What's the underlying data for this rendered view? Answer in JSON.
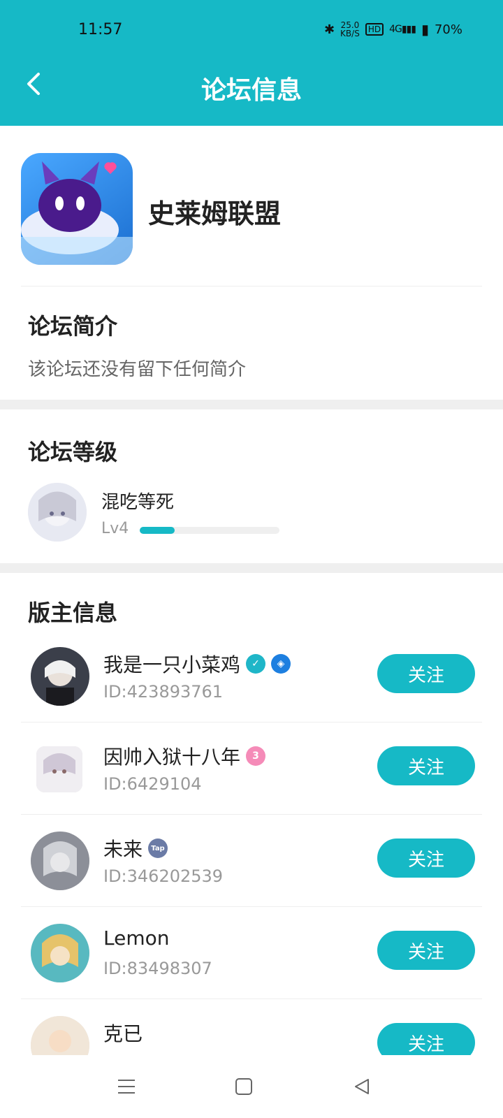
{
  "status": {
    "time": "11:57",
    "speed_value": "25.0",
    "speed_unit": "KB/S",
    "hd": "HD",
    "network": "4G",
    "battery": "70%"
  },
  "header": {
    "title": "论坛信息"
  },
  "forum": {
    "name": "史莱姆联盟"
  },
  "intro": {
    "heading": "论坛简介",
    "text": "该论坛还没有留下任何简介"
  },
  "level": {
    "heading": "论坛等级",
    "name": "混吃等死",
    "level_label": "Lv4",
    "progress_fraction": 0.25
  },
  "moderators": {
    "heading": "版主信息",
    "follow_label": "关注",
    "items": [
      {
        "name": "我是一只小菜鸡",
        "id": "ID:423893761"
      },
      {
        "name": "因帅入狱十八年",
        "id": "ID:6429104"
      },
      {
        "name": "未来",
        "id": "ID:346202539"
      },
      {
        "name": "Lemon",
        "id": "ID:83498307"
      },
      {
        "name": "克已",
        "id": ""
      }
    ],
    "badges": {
      "verified": "✓",
      "game": "◈",
      "pink": "3",
      "tap": "Tap"
    }
  },
  "colors": {
    "accent": "#16b9c6"
  }
}
